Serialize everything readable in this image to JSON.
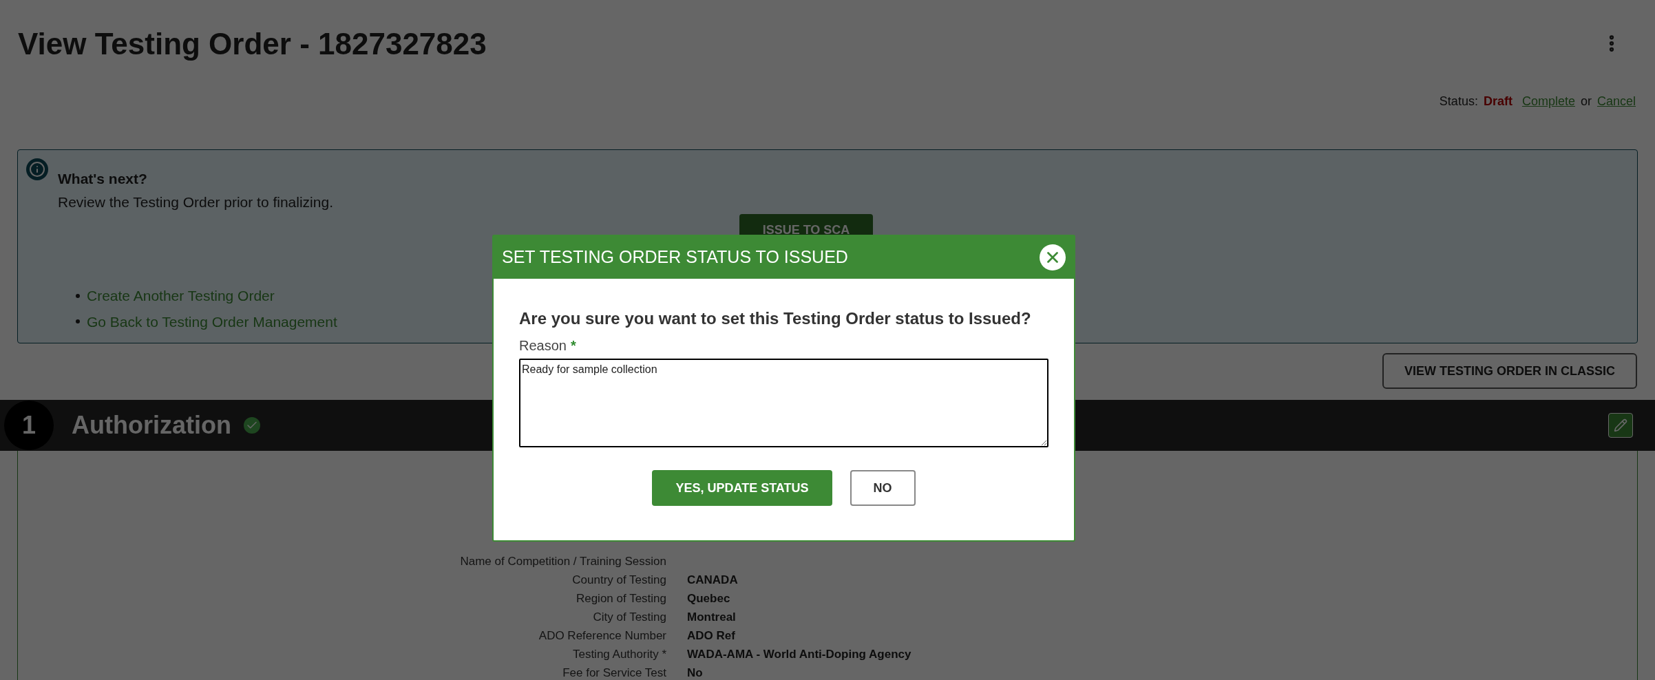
{
  "page": {
    "title": "View Testing Order - 1827327823",
    "status": {
      "label": "Status:",
      "value": "Draft",
      "separator": "or",
      "actions": [
        "Complete",
        "Cancel"
      ]
    }
  },
  "info": {
    "heading": "What's next?",
    "text": "Review the Testing Order prior to finalizing.",
    "button": "ISSUE TO SCA",
    "links": [
      "Create Another Testing Order",
      "Go Back to Testing Order Management"
    ]
  },
  "classic_button": "VIEW TESTING ORDER IN CLASSIC",
  "section": {
    "number": "1",
    "title": "Authorization",
    "complete": true,
    "fields": [
      {
        "label": "Name of Competition / Training Session"
      },
      {
        "label": "Country of Testing",
        "value": "CANADA"
      },
      {
        "label": "Region of Testing",
        "value": "Quebec"
      },
      {
        "label": "City of Testing",
        "value": "Montreal"
      },
      {
        "label": "ADO Reference Number",
        "value": "ADO Ref"
      },
      {
        "label": "Testing Authority *",
        "value": "WADA-AMA - World Anti-Doping Agency"
      },
      {
        "label": "Fee for Service Test",
        "value": "No"
      }
    ]
  },
  "dialog": {
    "title": "SET TESTING ORDER STATUS TO ISSUED",
    "question": "Are you sure you want to set this Testing Order status to Issued?",
    "reason_label": "Reason",
    "required_mark": "*",
    "reason_value": "Ready for sample collection",
    "buttons": [
      {
        "label": "YES, UPDATE STATUS",
        "kind": "primary"
      },
      {
        "label": "NO",
        "kind": "secondary"
      }
    ]
  }
}
